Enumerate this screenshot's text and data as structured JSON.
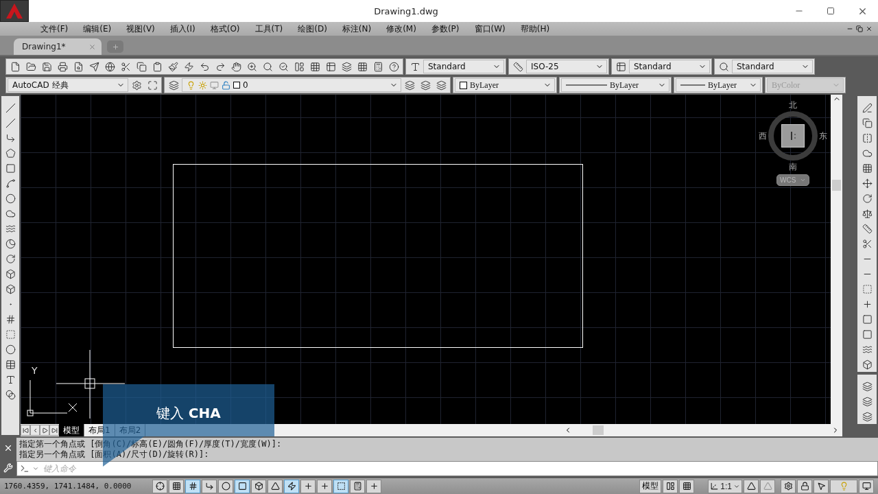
{
  "window": {
    "title": "Drawing1.dwg"
  },
  "menu": [
    "文件(F)",
    "编辑(E)",
    "视图(V)",
    "插入(I)",
    "格式(O)",
    "工具(T)",
    "绘图(D)",
    "标注(N)",
    "修改(M)",
    "参数(P)",
    "窗口(W)",
    "帮助(H)"
  ],
  "doc_tabs": [
    {
      "label": "Drawing1*",
      "selected": true
    }
  ],
  "style_combos": [
    {
      "value": "Standard"
    },
    {
      "value": "ISO-25"
    },
    {
      "value": "Standard"
    },
    {
      "value": "Standard"
    }
  ],
  "workspace": {
    "value": "AutoCAD 经典"
  },
  "layer": {
    "value": "0"
  },
  "properties": [
    {
      "kind": "color",
      "value": "ByLayer",
      "disabled": false
    },
    {
      "kind": "linetype",
      "value": "ByLayer",
      "disabled": false
    },
    {
      "kind": "lineweight",
      "value": "ByLayer",
      "disabled": false
    },
    {
      "kind": "plotstyle",
      "value": "ByColor",
      "disabled": true
    }
  ],
  "viewcube": {
    "north": "北",
    "south": "南",
    "east": "东",
    "west": "西",
    "ucs": "WCS"
  },
  "ucs_axis": {
    "y_label": "Y"
  },
  "layout_tabs": [
    {
      "label": "模型",
      "selected": true
    },
    {
      "label": "布局1",
      "selected": false
    },
    {
      "label": "布局2",
      "selected": false
    }
  ],
  "command_history": [
    "指定第一个角点或 [倒角(C)/标高(E)/圆角(F)/厚度(T)/宽度(W)]:",
    "指定另一个角点或 [面积(A)/尺寸(D)/旋转(R)]:"
  ],
  "command_input": {
    "placeholder": "键入命令"
  },
  "callout": {
    "text": "键入 **CHA**"
  },
  "status_bar": {
    "coordinates": "1760.4359, 1741.1484, 0.0000",
    "toggles": [
      {
        "on": false
      },
      {
        "on": false
      },
      {
        "on": true
      },
      {
        "on": false
      },
      {
        "on": false
      },
      {
        "on": true
      },
      {
        "on": false
      },
      {
        "on": false
      },
      {
        "on": true
      },
      {
        "on": false
      },
      {
        "on": false
      },
      {
        "on": true
      },
      {
        "on": false
      },
      {
        "on": false
      }
    ],
    "model": "模型",
    "annotation_scale": "1:1"
  }
}
